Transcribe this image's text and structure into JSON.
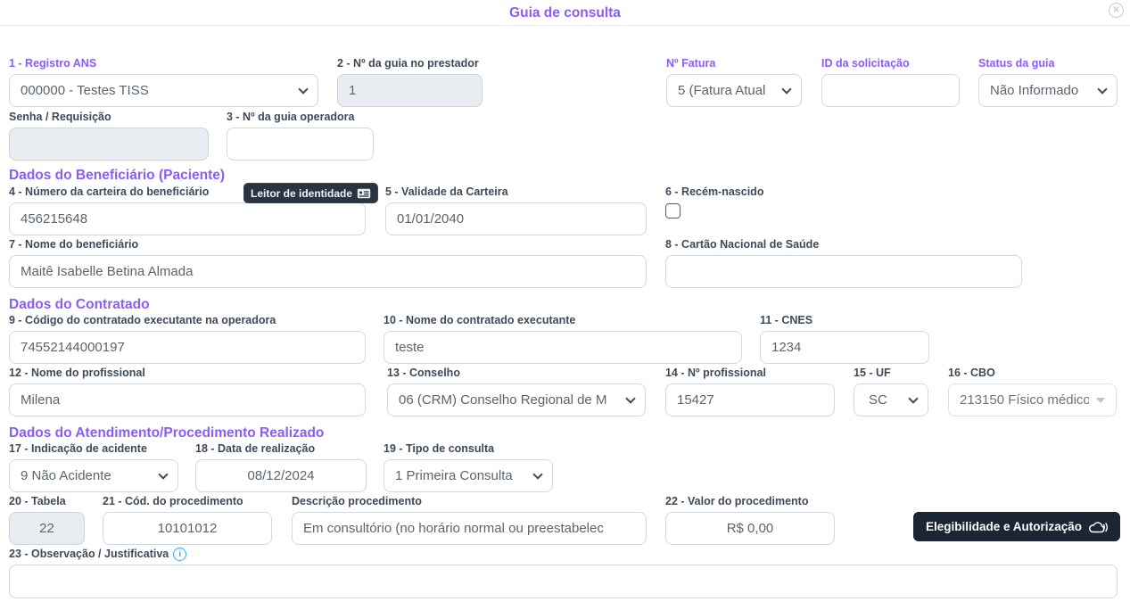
{
  "title": "Guia de consulta",
  "sections": {
    "beneficiario": "Dados do Beneficiário (Paciente)",
    "contratado": "Dados do Contratado",
    "atendimento": "Dados do Atendimento/Procedimento Realizado"
  },
  "buttons": {
    "leitor_identidade": "Leitor de identidade",
    "elegibilidade": "Elegibilidade e Autorização",
    "close": "✕"
  },
  "icons": {
    "close": "circle-x-icon",
    "id_card": "id-card-icon",
    "cloud_sync": "cloud-sync-icon",
    "info": "i"
  },
  "colors": {
    "accent_purple": "#8b5cf6",
    "label_dark": "#3e4a59",
    "dark_button": "#1b2533",
    "info_blue": "#2ab4e8"
  },
  "fields": {
    "registro_ans": {
      "label": "1 - Registro ANS",
      "value": "000000 - Testes TISS"
    },
    "guia_prestador": {
      "label": "2 - Nº da guia no prestador",
      "value": "1"
    },
    "n_fatura": {
      "label": "Nº Fatura",
      "value": "5 (Fatura Atual"
    },
    "id_solicitacao": {
      "label": "ID da solicitação",
      "value": ""
    },
    "status_guia": {
      "label": "Status da guia",
      "value": "Não Informado"
    },
    "senha_requisicao": {
      "label": "Senha / Requisição",
      "value": ""
    },
    "guia_operadora": {
      "label": "3 - Nº da guia operadora",
      "value": ""
    },
    "carteira": {
      "label": "4 - Número da carteira do beneficiário",
      "value": "456215648"
    },
    "validade": {
      "label": "5 - Validade da Carteira",
      "value": "01/01/2040"
    },
    "recem_nascido": {
      "label": "6 - Recém-nascido",
      "checked": false
    },
    "nome_beneficiario": {
      "label": "7 - Nome do beneficiário",
      "value": "Maitê Isabelle Betina Almada"
    },
    "cartao_sus": {
      "label": "8 - Cartão Nacional de Saúde",
      "value": ""
    },
    "codigo_contratado": {
      "label": "9 - Código do contratado executante na operadora",
      "value": "74552144000197"
    },
    "nome_contratado": {
      "label": "10 - Nome do contratado executante",
      "value": "teste"
    },
    "cnes": {
      "label": "11 - CNES",
      "value": "1234"
    },
    "nome_profissional": {
      "label": "12 - Nome do profissional",
      "value": "Milena"
    },
    "conselho": {
      "label": "13 - Conselho",
      "value": "06 (CRM) Conselho Regional de M"
    },
    "n_profissional": {
      "label": "14 - Nº profissional",
      "value": "15427"
    },
    "uf": {
      "label": "15 - UF",
      "value": "SC"
    },
    "cbo": {
      "label": "16 - CBO",
      "value": "213150 Físico médico"
    },
    "indicacao_acidente": {
      "label": "17 - Indicação de acidente",
      "value": "9 Não Acidente"
    },
    "data_realizacao": {
      "label": "18 - Data de realização",
      "value": "08/12/2024"
    },
    "tipo_consulta": {
      "label": "19 - Tipo de consulta",
      "value": "1 Primeira Consulta"
    },
    "tabela": {
      "label": "20 - Tabela",
      "value": "22"
    },
    "cod_procedimento": {
      "label": "21 - Cód. do procedimento",
      "value": "10101012"
    },
    "descricao_procedimento": {
      "label": "Descrição procedimento",
      "value": "Em consultório (no horário normal ou preestabelec"
    },
    "valor_procedimento": {
      "label": "22 - Valor do procedimento",
      "value": "R$ 0,00"
    },
    "observacao": {
      "label": "23 - Observação / Justificativa",
      "value": ""
    }
  }
}
